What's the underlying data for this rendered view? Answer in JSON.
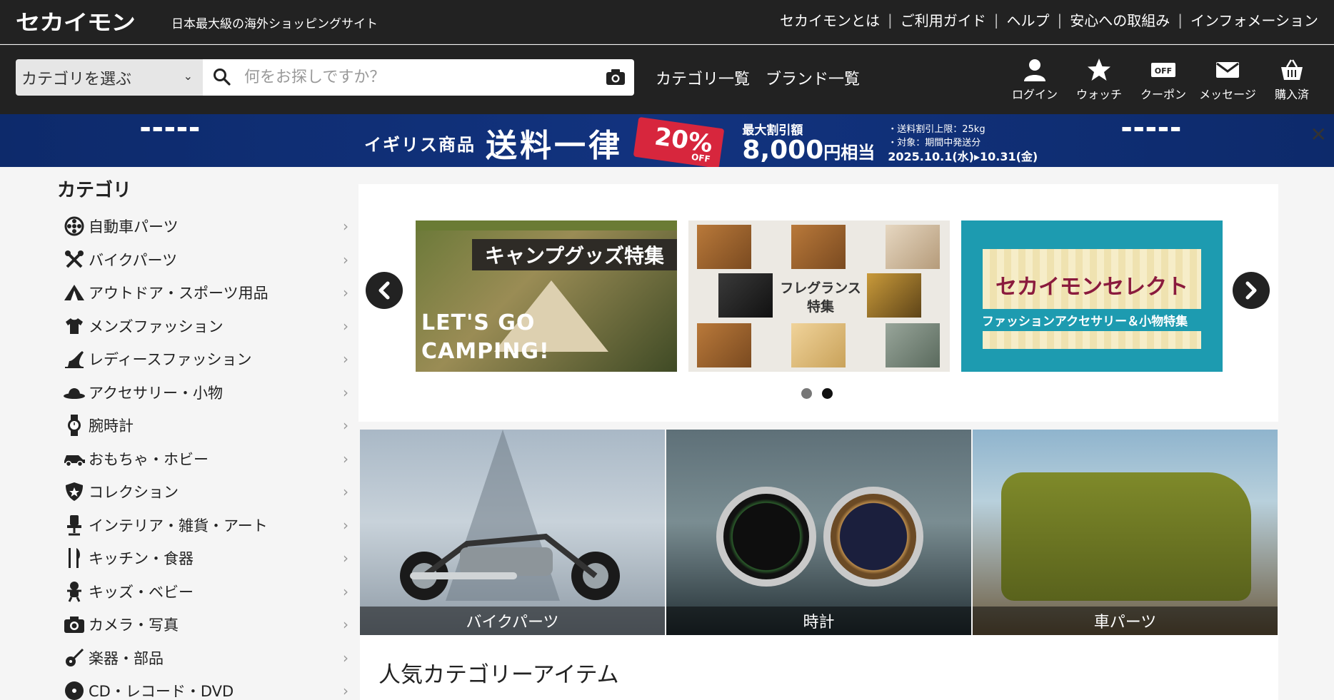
{
  "header": {
    "logo": "セカイモン",
    "tagline": "日本最大級の海外ショッピングサイト",
    "nav": [
      "セカイモンとは",
      "ご利用ガイド",
      "ヘルプ",
      "安心への取組み",
      "インフォメーション"
    ]
  },
  "search": {
    "category_select": "カテゴリを選ぶ",
    "placeholder": "何をお探しですか？",
    "links": [
      "カテゴリ一覧",
      "ブランド一覧"
    ],
    "user_icons": [
      {
        "label": "ログイン",
        "icon": "user-icon"
      },
      {
        "label": "ウォッチ",
        "icon": "star-icon"
      },
      {
        "label": "クーポン",
        "icon": "coupon-icon"
      },
      {
        "label": "メッセージ",
        "icon": "mail-icon"
      },
      {
        "label": "購入済",
        "icon": "basket-icon"
      }
    ]
  },
  "banner": {
    "prefix": "イギリス商品",
    "headline": "送料一律",
    "discount": "20%",
    "discount_sub": "OFF",
    "max_label": "最大割引額",
    "max_value": "8,000",
    "max_unit": "円相当",
    "note1": "・送料割引上限：25kg",
    "note2": "・対象：期間中発送分",
    "dates": "2025.10.1(水)▸10.31(金)",
    "close": "✕"
  },
  "sidebar": {
    "title": "カテゴリ",
    "items": [
      {
        "label": "自動車パーツ",
        "icon": "wheel-icon"
      },
      {
        "label": "バイクパーツ",
        "icon": "tools-icon"
      },
      {
        "label": "アウトドア・スポーツ用品",
        "icon": "tent-icon"
      },
      {
        "label": "メンズファッション",
        "icon": "tshirt-icon"
      },
      {
        "label": "レディースファッション",
        "icon": "heel-icon"
      },
      {
        "label": "アクセサリー・小物",
        "icon": "hat-icon"
      },
      {
        "label": "腕時計",
        "icon": "watch-icon"
      },
      {
        "label": "おもちゃ・ホビー",
        "icon": "toy-car-icon"
      },
      {
        "label": "コレクション",
        "icon": "shield-icon"
      },
      {
        "label": "インテリア・雑貨・アート",
        "icon": "chair-icon"
      },
      {
        "label": "キッチン・食器",
        "icon": "fork-knife-icon"
      },
      {
        "label": "キッズ・ベビー",
        "icon": "baby-icon"
      },
      {
        "label": "カメラ・写真",
        "icon": "camera-icon"
      },
      {
        "label": "楽器・部品",
        "icon": "guitar-icon"
      },
      {
        "label": "CD・レコード・DVD",
        "icon": "disc-icon"
      }
    ]
  },
  "carousel": {
    "slides": [
      {
        "title": "キャンプグッズ特集",
        "text": "LET'S GO CAMPING!"
      },
      {
        "title": "フレグランス特集"
      },
      {
        "title": "セカイモンセレクト",
        "subtitle": "ファッションアクセサリー＆小物特集"
      }
    ]
  },
  "features": [
    {
      "label": "バイクパーツ"
    },
    {
      "label": "時計"
    },
    {
      "label": "車パーツ"
    }
  ],
  "popular": {
    "title": "人気カテゴリーアイテム"
  },
  "colors": {
    "header_bg": "#222222",
    "banner_bg": "#12337f",
    "accent_red": "#d7263d",
    "page_bg": "#f5f5f5"
  }
}
